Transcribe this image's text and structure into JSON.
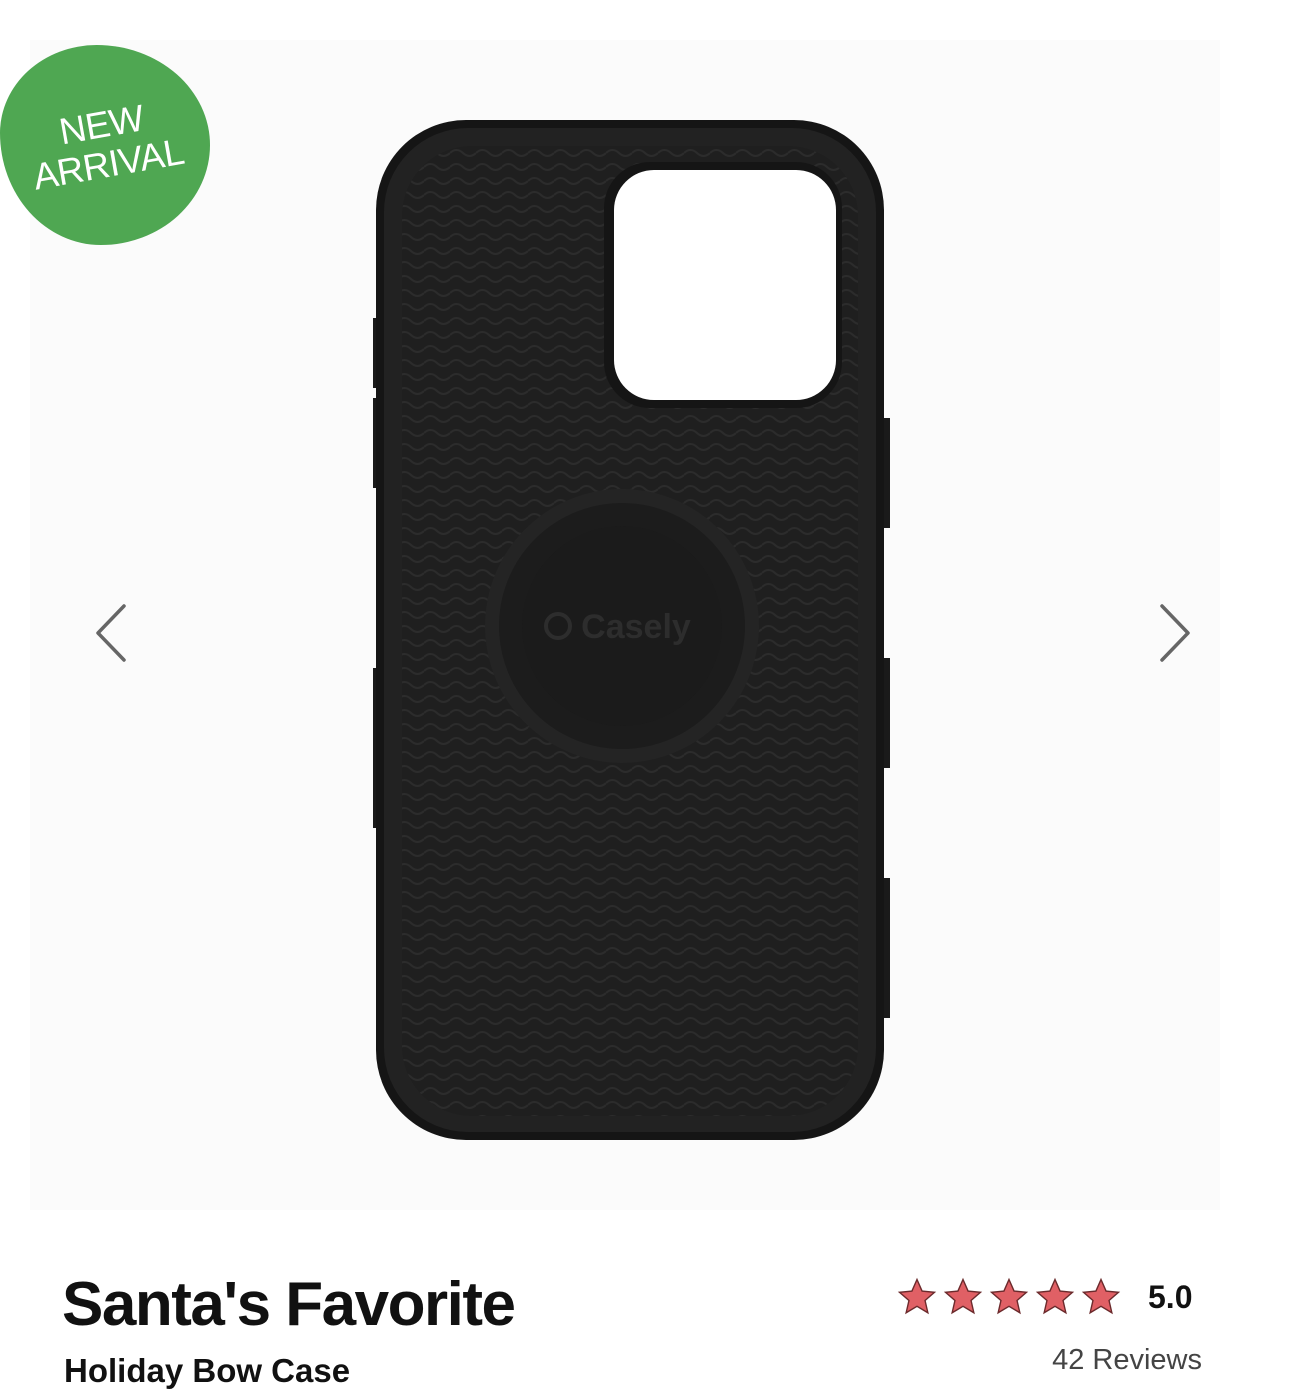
{
  "badge": {
    "line1": "NEW",
    "line2": "ARRIVAL",
    "color": "#4fa752"
  },
  "gallery": {
    "prev_icon": "chevron-left-icon",
    "next_icon": "chevron-right-icon",
    "product_image": "black phone case interior with Casely logo",
    "logo_text": "Casely"
  },
  "product": {
    "title": "Santa's Favorite",
    "subtitle": "Holiday Bow Case",
    "rating": 5.0,
    "rating_label": "5.0",
    "star_count": 5,
    "star_color": "#e06065",
    "reviews_label": "42 Reviews"
  }
}
